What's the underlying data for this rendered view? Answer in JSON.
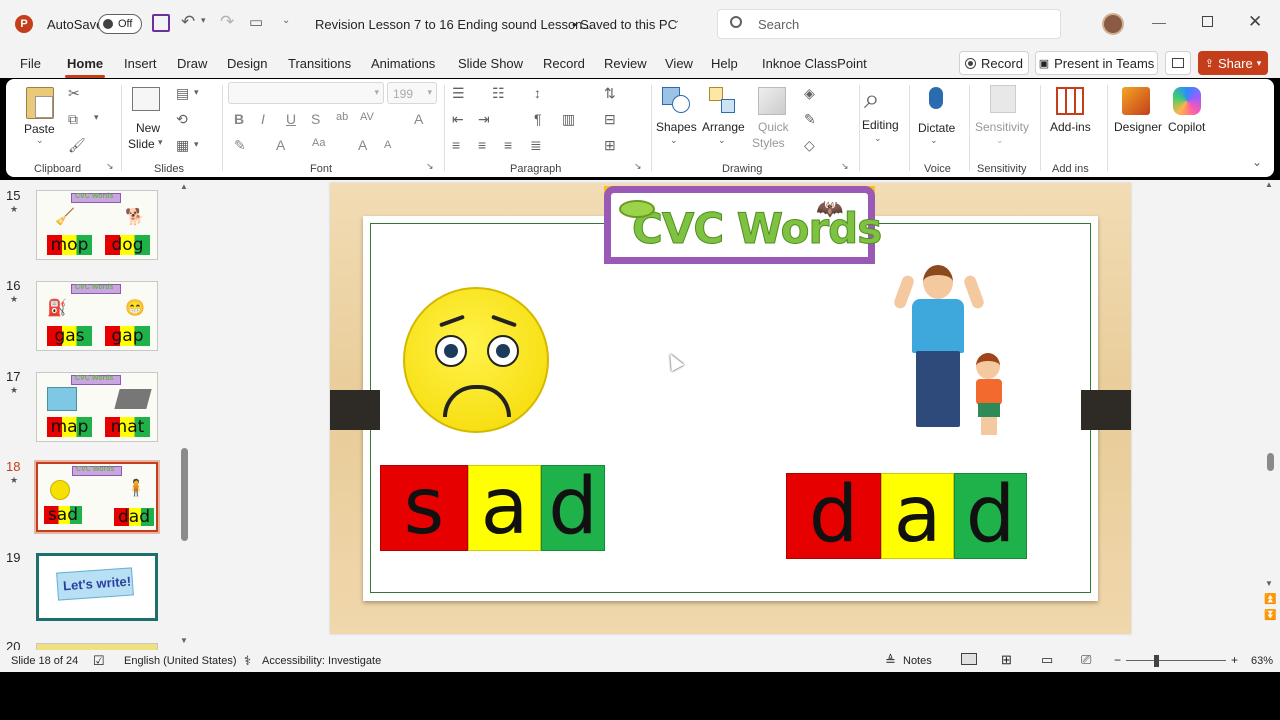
{
  "titlebar": {
    "autosave_label": "AutoSave",
    "autosave_state": "Off",
    "doc_title": "Revision Lesson 7 to 16 Ending sound Lesson...",
    "save_status": "• Saved to this PC",
    "search_placeholder": "Search"
  },
  "tabs": [
    "File",
    "Home",
    "Insert",
    "Draw",
    "Design",
    "Transitions",
    "Animations",
    "Slide Show",
    "Record",
    "Review",
    "View",
    "Help",
    "Inknoe ClassPoint"
  ],
  "actions": {
    "record": "Record",
    "present": "Present in Teams",
    "share": "Share"
  },
  "ribbon": {
    "clipboard": {
      "paste": "Paste",
      "label": "Clipboard"
    },
    "slides": {
      "new_slide_1": "New",
      "new_slide_2": "Slide",
      "label": "Slides"
    },
    "font": {
      "name": "",
      "size": "199",
      "label": "Font"
    },
    "paragraph": {
      "label": "Paragraph"
    },
    "drawing": {
      "shapes": "Shapes",
      "arrange": "Arrange",
      "quick_styles_1": "Quick",
      "quick_styles_2": "Styles",
      "label": "Drawing"
    },
    "editing": {
      "label": "Editing"
    },
    "voice": {
      "dictate": "Dictate",
      "label": "Voice"
    },
    "sensitivity": {
      "button": "Sensitivity",
      "label": "Sensitivity"
    },
    "addins": {
      "button": "Add-ins",
      "label": "Add ins"
    },
    "designer": "Designer",
    "copilot": "Copilot"
  },
  "thumbnails": [
    {
      "num": "15",
      "title": "CVC Words",
      "words": [
        "mop",
        "dog"
      ]
    },
    {
      "num": "16",
      "title": "CVC Words",
      "words": [
        "gas",
        "gap"
      ]
    },
    {
      "num": "17",
      "title": "CVC Words",
      "words": [
        "map",
        "mat"
      ]
    },
    {
      "num": "18",
      "title": "CVC Words",
      "words": [
        "sad",
        "dad"
      ]
    },
    {
      "num": "19",
      "title": "Let's write!"
    },
    {
      "num": "20"
    }
  ],
  "slide": {
    "banner": "CVC Words",
    "word1": [
      "s",
      "a",
      "d"
    ],
    "word2": [
      "d",
      "a",
      "d"
    ]
  },
  "colors": {
    "red": "#e60000",
    "yellow": "#ffff00",
    "green": "#1fb14a",
    "accent": "#c43e1c"
  },
  "status": {
    "slide_info": "Slide 18 of 24",
    "language": "English (United States)",
    "accessibility": "Accessibility: Investigate",
    "notes": "Notes",
    "zoom": "63%"
  }
}
